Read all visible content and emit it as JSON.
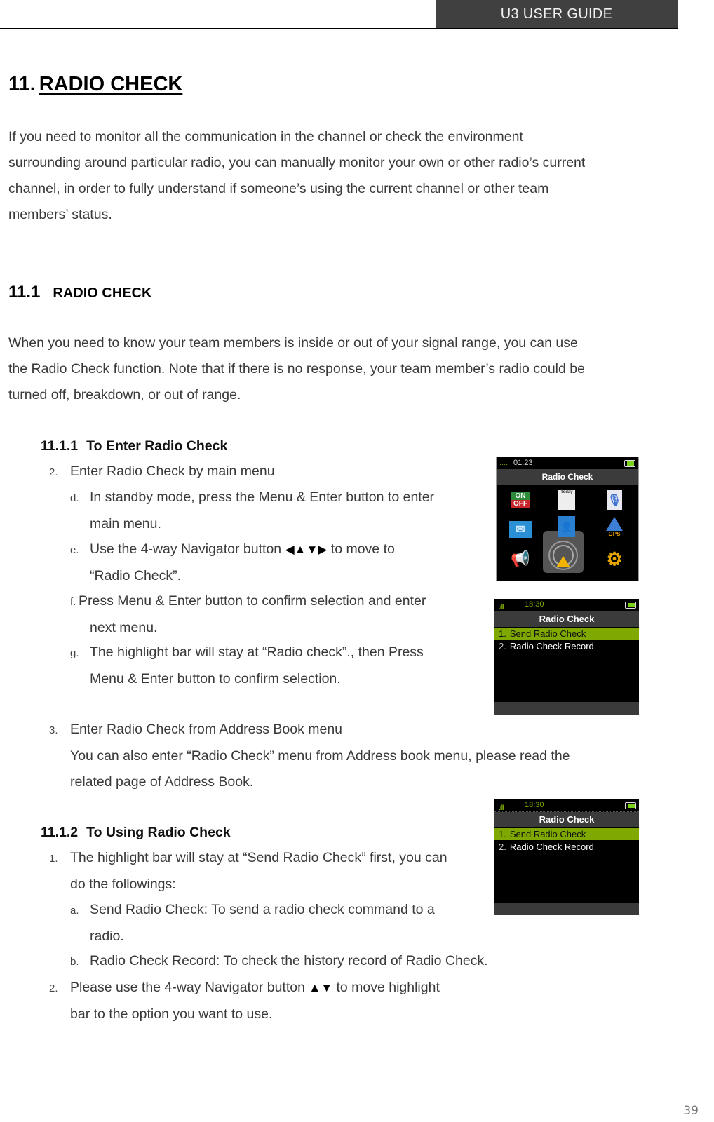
{
  "header": {
    "guide_title": "U3 USER GUIDE"
  },
  "chapter": {
    "number": "11.",
    "title": "RADIO CHECK",
    "intro": [
      "If you need to monitor all the communication in the channel or check the environment",
      "surrounding around particular radio, you can manually monitor your own or other radio’s current",
      "channel, in order to fully understand if someone’s using the current channel or other team",
      "members’ status."
    ]
  },
  "section": {
    "number": "11.1",
    "title": "RADIO CHECK",
    "body": [
      "When you need to know your team members is inside or out of your signal range, you can use",
      "the Radio Check function. Note that if there is no response, your team member’s radio could be",
      "turned off, breakdown, or out of range."
    ]
  },
  "sub1": {
    "number": "11.1.1",
    "title": "To Enter Radio Check",
    "item2": {
      "marker": "2.",
      "text": "Enter Radio Check by main menu"
    },
    "d": {
      "marker": "d.",
      "line1": "In standby mode, press the Menu & Enter button to enter",
      "line2": "main menu."
    },
    "e": {
      "marker": "e.",
      "pre": "Use the 4-way Navigator button ",
      "arrows": "◀▲▼▶",
      "post": " to move to",
      "line2": "“Radio Check”."
    },
    "f": {
      "marker": "f.",
      "line1": "Press Menu & Enter button to confirm selection and enter",
      "line2": "next menu."
    },
    "g": {
      "marker": "g.",
      "line1": "The highlight bar will stay at “Radio check”., then Press",
      "line2": "Menu & Enter button to confirm selection."
    },
    "item3": {
      "marker": "3.",
      "text": "Enter Radio Check from Address Book menu",
      "line2": "You can also enter “Radio Check” menu from Address book menu, please read the",
      "line3": "related page of Address Book."
    }
  },
  "sub2": {
    "number": "11.1.2",
    "title": "To Using Radio Check",
    "item1": {
      "marker": "1.",
      "line1": "The highlight bar will stay at “Send Radio Check” first, you can",
      "line2": "do the followings:"
    },
    "a": {
      "marker": "a.",
      "line1": "Send Radio Check: To send a radio check command to a",
      "line2": "radio."
    },
    "b": {
      "marker": "b.",
      "line1": "Radio Check Record: To check the history record of Radio Check."
    },
    "item2": {
      "marker": "2.",
      "pre": "Please use the 4-way Navigator button ",
      "arrows": "▲▼",
      "post": " to move highlight",
      "line2": "bar to the option you want to use."
    }
  },
  "screens": {
    "main_menu": {
      "time": "01:23",
      "title": "Radio Check",
      "icons": [
        "on-off-icon",
        "calendar-icon",
        "voice-memo-icon",
        "message-icon",
        "address-book-icon",
        "gps-icon",
        "alarm-speaker-icon",
        "radio-check-icon",
        "settings-icon"
      ],
      "on_label": "ON",
      "off_label": "OFF",
      "gps_label": "GPS",
      "today_label": "Today"
    },
    "radio_check_menu": {
      "signal": ".ıll",
      "time": "18:30",
      "title": "Radio Check",
      "items": [
        {
          "n": "1.",
          "label": "Send Radio Check",
          "highlighted": true
        },
        {
          "n": "2.",
          "label": "Radio Check Record",
          "highlighted": false
        }
      ]
    },
    "accent_color": "#7fa800"
  },
  "page_number": "39"
}
